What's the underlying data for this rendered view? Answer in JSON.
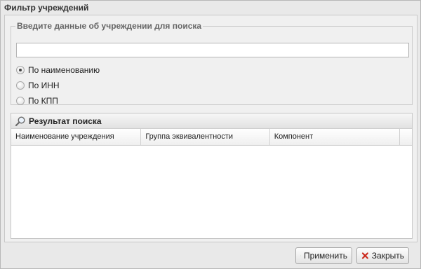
{
  "dialog": {
    "title": "Фильтр учреждений"
  },
  "search_group": {
    "legend": "Введите данные об учреждении для поиска",
    "input_value": "",
    "input_placeholder": "",
    "options": [
      {
        "label": "По наименованию",
        "checked": true
      },
      {
        "label": "По ИНН",
        "checked": false
      },
      {
        "label": "По КПП",
        "checked": false
      }
    ]
  },
  "results": {
    "title": "Результат поиска",
    "icon": "magnifier-icon",
    "columns": [
      "Наименование учреждения",
      "Группа эквивалентности",
      "Компонент"
    ],
    "rows": []
  },
  "footer": {
    "apply_label": "Применить",
    "apply_icon": "checkmark-icon",
    "close_label": "Закрыть",
    "close_icon": "close-x-icon"
  },
  "colors": {
    "apply_icon": "#3aa62e",
    "close_icon": "#cc2a1e"
  }
}
